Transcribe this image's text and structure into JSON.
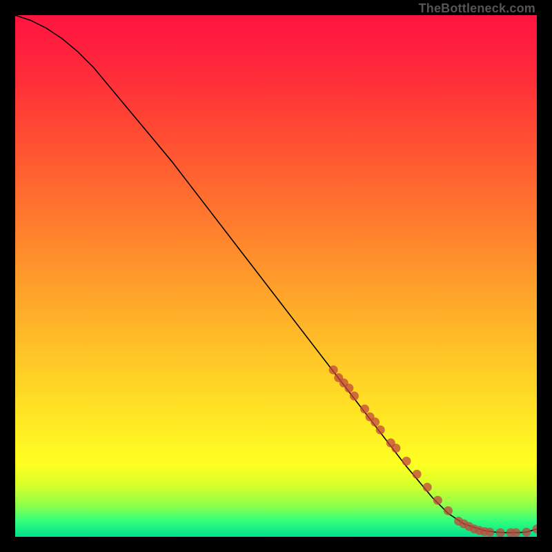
{
  "attribution": "TheBottleneck.com",
  "chart_data": {
    "type": "line",
    "title": "",
    "xlabel": "",
    "ylabel": "",
    "xlim": [
      0,
      100
    ],
    "ylim": [
      0,
      100
    ],
    "series": [
      {
        "name": "curve",
        "x": [
          0,
          3,
          6,
          9,
          12,
          15,
          20,
          25,
          30,
          35,
          40,
          45,
          50,
          55,
          60,
          65,
          70,
          75,
          80,
          83,
          86,
          88,
          90,
          92,
          94,
          96,
          98,
          100
        ],
        "y": [
          100,
          99,
          97.5,
          95.5,
          93,
          90,
          84,
          78,
          72,
          65.5,
          59,
          52.5,
          46,
          39.5,
          33,
          26.5,
          20,
          13.5,
          7.5,
          4.5,
          2.5,
          1.8,
          1.2,
          0.9,
          0.8,
          0.8,
          0.9,
          1.5
        ]
      },
      {
        "name": "markers",
        "x": [
          61,
          62,
          63,
          64,
          65,
          67,
          68,
          69,
          70,
          72,
          73,
          75,
          77,
          79,
          81,
          83,
          85,
          86,
          87,
          88,
          89,
          90,
          91,
          93,
          95,
          96,
          98,
          100
        ],
        "y": [
          32,
          30.5,
          29.5,
          28.5,
          27,
          24.5,
          23,
          22,
          20.5,
          18,
          17,
          14.5,
          12,
          9.5,
          7,
          5,
          3,
          2.5,
          2,
          1.5,
          1.2,
          1.0,
          0.9,
          0.8,
          0.8,
          0.8,
          0.9,
          1.5
        ]
      }
    ],
    "colors": {
      "curve": "#000000",
      "marker_fill": "#c0453c",
      "marker_stroke": "#c0453c"
    }
  }
}
